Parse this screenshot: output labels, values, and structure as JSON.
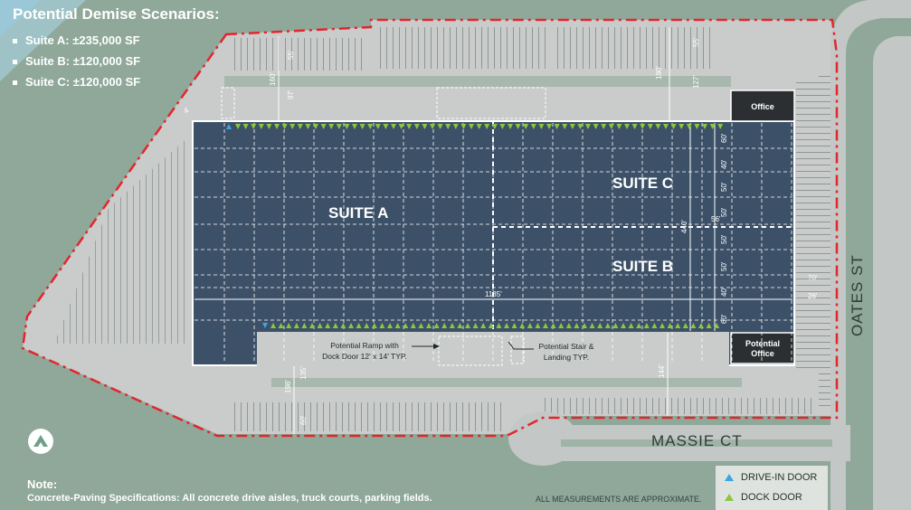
{
  "scenarios": {
    "title": "Potential Demise Scenarios:",
    "items": [
      "Suite A: ±235,000 SF",
      "Suite B: ±120,000 SF",
      "Suite C: ±120,000 SF"
    ]
  },
  "suites": {
    "a": "SUITE A",
    "b": "SUITE B",
    "c": "SUITE C"
  },
  "offices": {
    "top": "Office",
    "bottom_line1": "Potential",
    "bottom_line2": "Office"
  },
  "streets": {
    "east": "OATES ST",
    "south": "MASSIE CT"
  },
  "callouts": {
    "ramp_line1": "Potential Ramp with",
    "ramp_line2": "Dock Door 12' x 14' TYP.",
    "stair_line1": "Potential Stair &",
    "stair_line2": "Landing TYP."
  },
  "dimensions": {
    "d160": "160'",
    "d55a": "55'",
    "d97": "97'",
    "d190": "190'",
    "d55b": "55'",
    "d127": "127'",
    "d1135": "1135'",
    "d56": "56'",
    "d440": "440'",
    "d60a": "60'",
    "d40a": "40'",
    "d50a": "50'",
    "d50b": "50'",
    "d50c": "50'",
    "d50d": "50'",
    "d40b": "40'",
    "d60b": "60'",
    "d70": "70'",
    "d26": "26'",
    "d4": "4'",
    "d198": "198'",
    "d135": "135'",
    "d60c": "60'",
    "d144": "144'"
  },
  "note": {
    "title": "Note:",
    "text": "Concrete-Paving Specifications: All concrete drive aisles, truck courts, parking fields."
  },
  "disclaimer": "ALL MEASUREMENTS ARE APPROXIMATE.",
  "legend": {
    "drive_in": "DRIVE-IN DOOR",
    "dock": "DOCK DOOR"
  },
  "colors": {
    "ground": "#8fa89a",
    "paving": "#c9ccca",
    "building": "#3c5168",
    "office": "#2c2f31",
    "boundary": "#e3262c",
    "drive_in": "#3aa7e0",
    "dock": "#8cc63f"
  }
}
